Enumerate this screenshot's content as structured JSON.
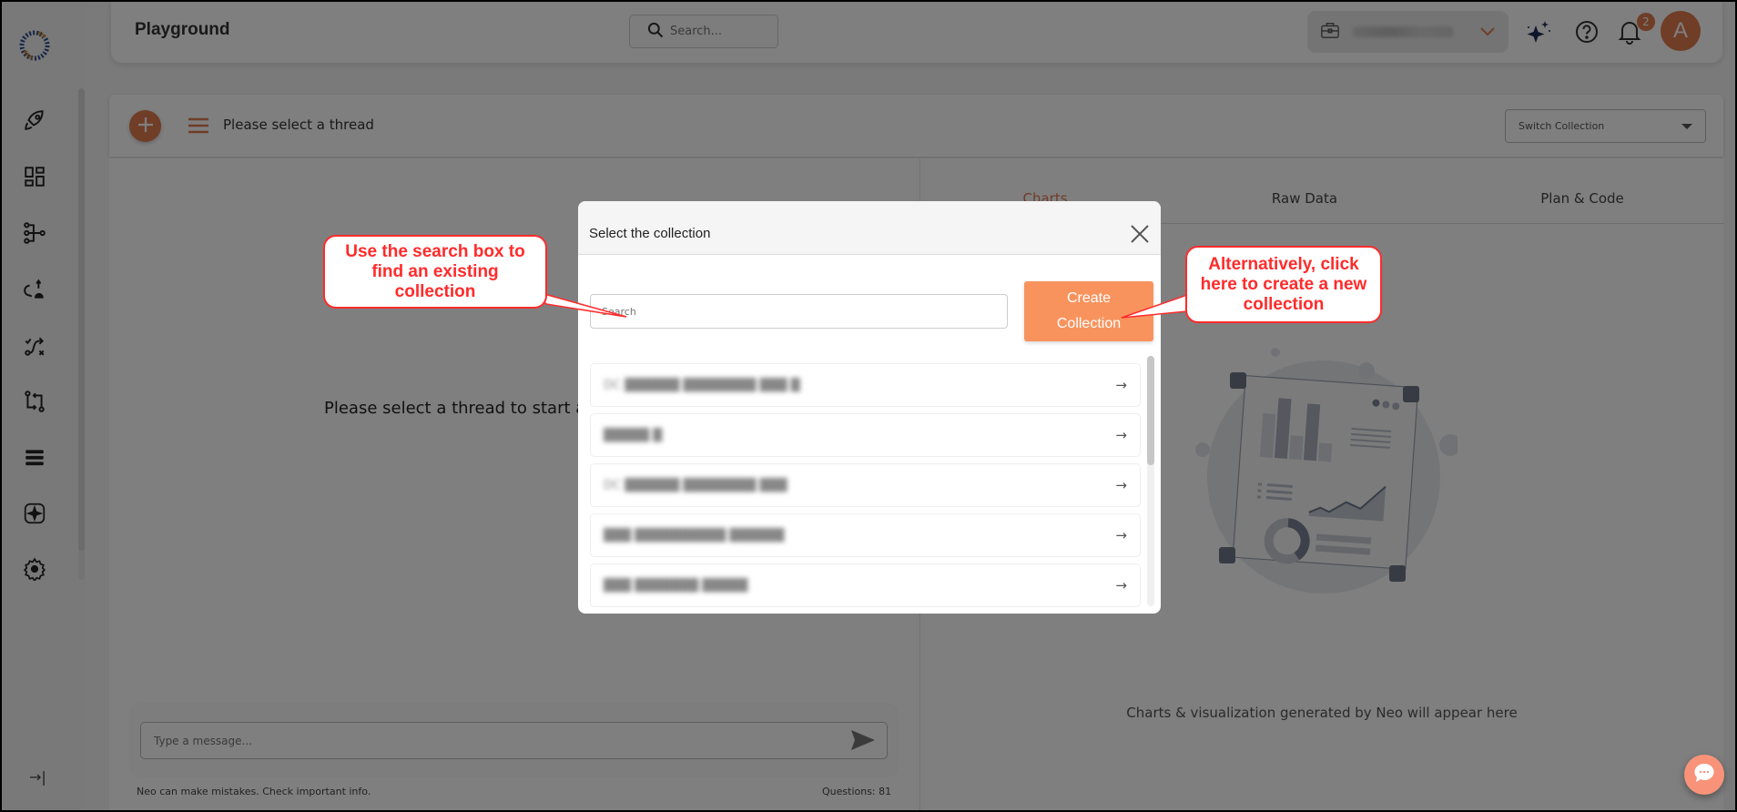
{
  "header": {
    "title": "Playground",
    "search_placeholder": "Search...",
    "org_selector": {
      "value": "(redacted)"
    },
    "notifications_count": "2",
    "avatar_initial": "A"
  },
  "sidebar": {
    "items": [
      {
        "name": "rocket-icon"
      },
      {
        "name": "dashboard-icon"
      },
      {
        "name": "pipeline-icon"
      },
      {
        "name": "transform-icon"
      },
      {
        "name": "route-icon"
      },
      {
        "name": "compare-icon"
      },
      {
        "name": "list-icon"
      },
      {
        "name": "ai-icon"
      },
      {
        "name": "settings-icon"
      }
    ],
    "collapse_label": "→|"
  },
  "thread_bar": {
    "title": "Please select a thread",
    "switch_collection_label": "Switch Collection"
  },
  "left_panel": {
    "empty_message": "Please select a thread to start asking questions",
    "message_placeholder": "Type a message...",
    "disclaimer": "Neo can make mistakes. Check important info.",
    "questions_count": "Questions: 81"
  },
  "right_panel": {
    "tabs": [
      {
        "label": "Charts",
        "active": true
      },
      {
        "label": "Raw Data",
        "active": false
      },
      {
        "label": "Plan & Code",
        "active": false
      }
    ],
    "empty_caption": "Charts & visualization generated by Neo will appear here"
  },
  "modal": {
    "title": "Select the collection",
    "search_placeholder": "Search",
    "create_button": {
      "line1": "Create",
      "line2": "Collection"
    },
    "collections": [
      {
        "name": "DC ██████ ████████ ███ █"
      },
      {
        "name": "█████ █"
      },
      {
        "name": "DC ██████ ████████ ███"
      },
      {
        "name": "███ ██████████ ██████"
      },
      {
        "name": "███ ███████ █████"
      }
    ],
    "arrow_glyph": "→"
  },
  "annotations": {
    "search_hint": "Use the search box to find an existing collection",
    "create_hint": "Alternatively, click here to create a new collection"
  },
  "colors": {
    "accent": "#e07a4e",
    "create_button": "#f9935e",
    "callout": "#ff2b2b"
  }
}
